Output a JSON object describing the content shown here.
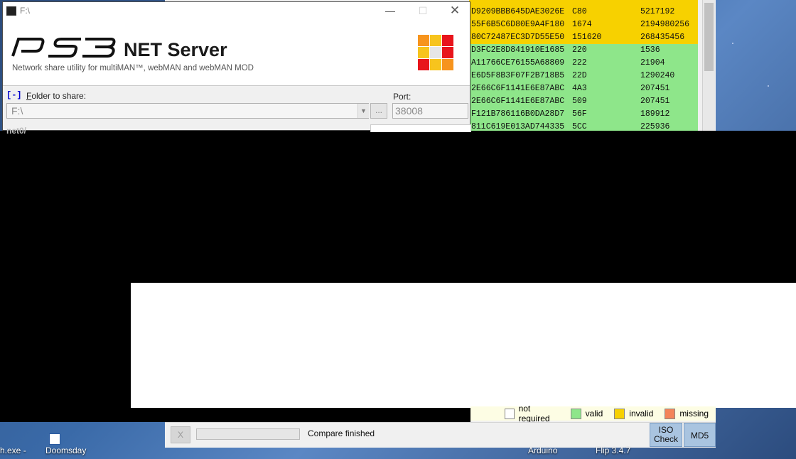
{
  "ps3_window": {
    "title": "F:\\",
    "logo_text": "PS3",
    "heading": "NET Server",
    "subtitle": "Network share utility for multiMAN™, webMAN and webMAN MOD",
    "toggle": "[-]",
    "folder_label_accel": "F",
    "folder_label_rest": "older to share:",
    "folder_value": "F:\\",
    "browse_label": "...",
    "port_label": "Port:",
    "port_value": "38008",
    "cut_label": "net0/",
    "logo_colors": [
      "#f7941d",
      "#f7c41d",
      "#e8141b",
      "#f7c41d",
      "#e6e6e6",
      "#e8141b",
      "#e8141b",
      "#f7c41d",
      "#f7941d"
    ]
  },
  "hash_rows": [
    {
      "status": "invalid",
      "hash": "D9209BBB645DAE3026E",
      "offset": "C80",
      "size": "5217192"
    },
    {
      "status": "invalid",
      "hash": "55F6B5C6D80E9A4F180",
      "offset": "1674",
      "size": "2194980256"
    },
    {
      "status": "invalid",
      "hash": "80C72487EC3D7D55E50",
      "offset": "151620",
      "size": "268435456"
    },
    {
      "status": "valid",
      "hash": "D3FC2E8D841910E1685",
      "offset": "220",
      "size": "1536"
    },
    {
      "status": "valid",
      "hash": "A11766CE76155A68809",
      "offset": "222",
      "size": "21904"
    },
    {
      "status": "valid",
      "hash": "E6D5F8B3F07F2B718B5",
      "offset": "22D",
      "size": "1290240"
    },
    {
      "status": "valid",
      "hash": "2E66C6F1141E6E87ABC",
      "offset": "4A3",
      "size": "207451"
    },
    {
      "status": "valid",
      "hash": "2E66C6F1141E6E87ABC",
      "offset": "509",
      "size": "207451"
    },
    {
      "status": "valid",
      "hash": "F121B786116B0DA28D7",
      "offset": "56F",
      "size": "189912"
    },
    {
      "status": "valid",
      "hash": "811C619E013AD744335",
      "offset": "5CC",
      "size": "225936"
    }
  ],
  "legend": {
    "items": [
      {
        "label": "not required",
        "color": "#ffffff"
      },
      {
        "label": "valid",
        "color": "#8ee68a"
      },
      {
        "label": "invalid",
        "color": "#f7d100"
      },
      {
        "label": "missing",
        "color": "#f4845a"
      }
    ]
  },
  "status": {
    "cancel_label": "X",
    "progress": 0,
    "message": "Compare finished",
    "iso_check_line1": "ISO",
    "iso_check_line2": "Check",
    "md5_label": "MD5"
  },
  "desktop": {
    "label_exe": "h.exe -",
    "label_doomsday": "Doomsday",
    "label_arduino": "Arduino",
    "label_flip": "Flip 3.4.7"
  }
}
